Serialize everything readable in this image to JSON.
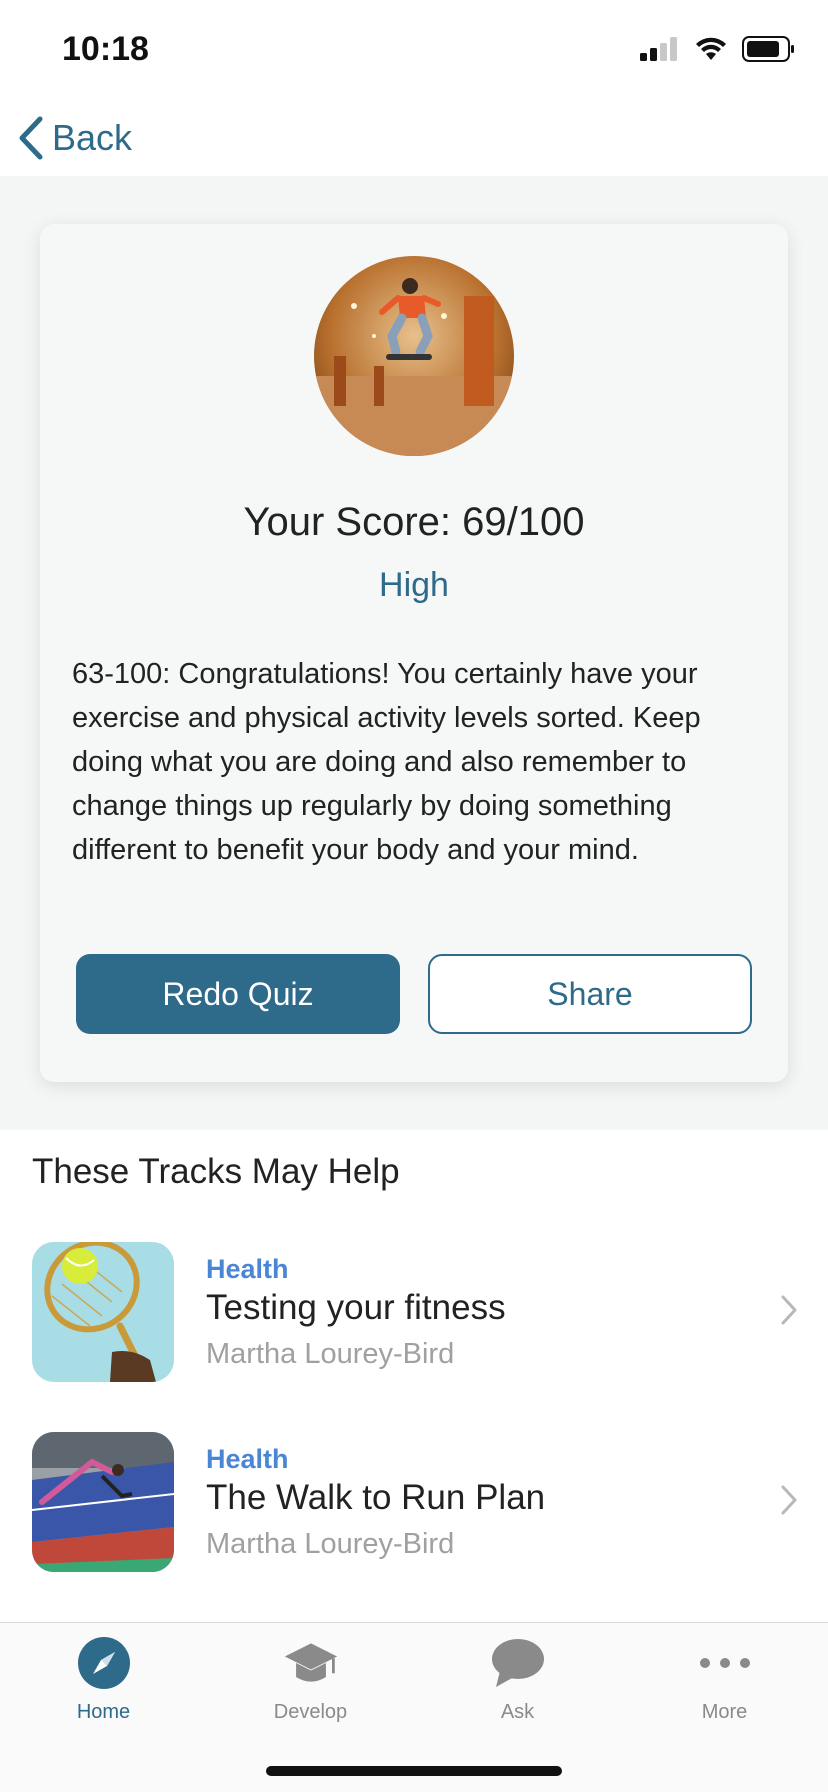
{
  "status_bar": {
    "time": "10:18"
  },
  "nav": {
    "back_label": "Back"
  },
  "result": {
    "score_title": "Your Score: 69/100",
    "level": "High",
    "description": "63-100: Congratulations! You certainly have your exercise and physical activity levels sorted. Keep doing what you are doing and also remember to change things up regularly by doing something different to benefit your body and your mind.",
    "redo_label": "Redo Quiz",
    "share_label": "Share"
  },
  "tracks_section": {
    "title": "These Tracks May Help",
    "items": [
      {
        "category": "Health",
        "title": "Testing your fitness",
        "author": "Martha Lourey-Bird"
      },
      {
        "category": "Health",
        "title": "The Walk to Run Plan",
        "author": "Martha Lourey-Bird"
      }
    ]
  },
  "tab_bar": {
    "tabs": [
      {
        "label": "Home",
        "icon": "compass-icon",
        "active": true
      },
      {
        "label": "Develop",
        "icon": "graduation-cap-icon",
        "active": false
      },
      {
        "label": "Ask",
        "icon": "chat-bubble-icon",
        "active": false
      },
      {
        "label": "More",
        "icon": "more-dots-icon",
        "active": false
      }
    ]
  },
  "colors": {
    "accent": "#2e6a8a",
    "category": "#4a86d4",
    "muted": "#a0a0a0"
  }
}
